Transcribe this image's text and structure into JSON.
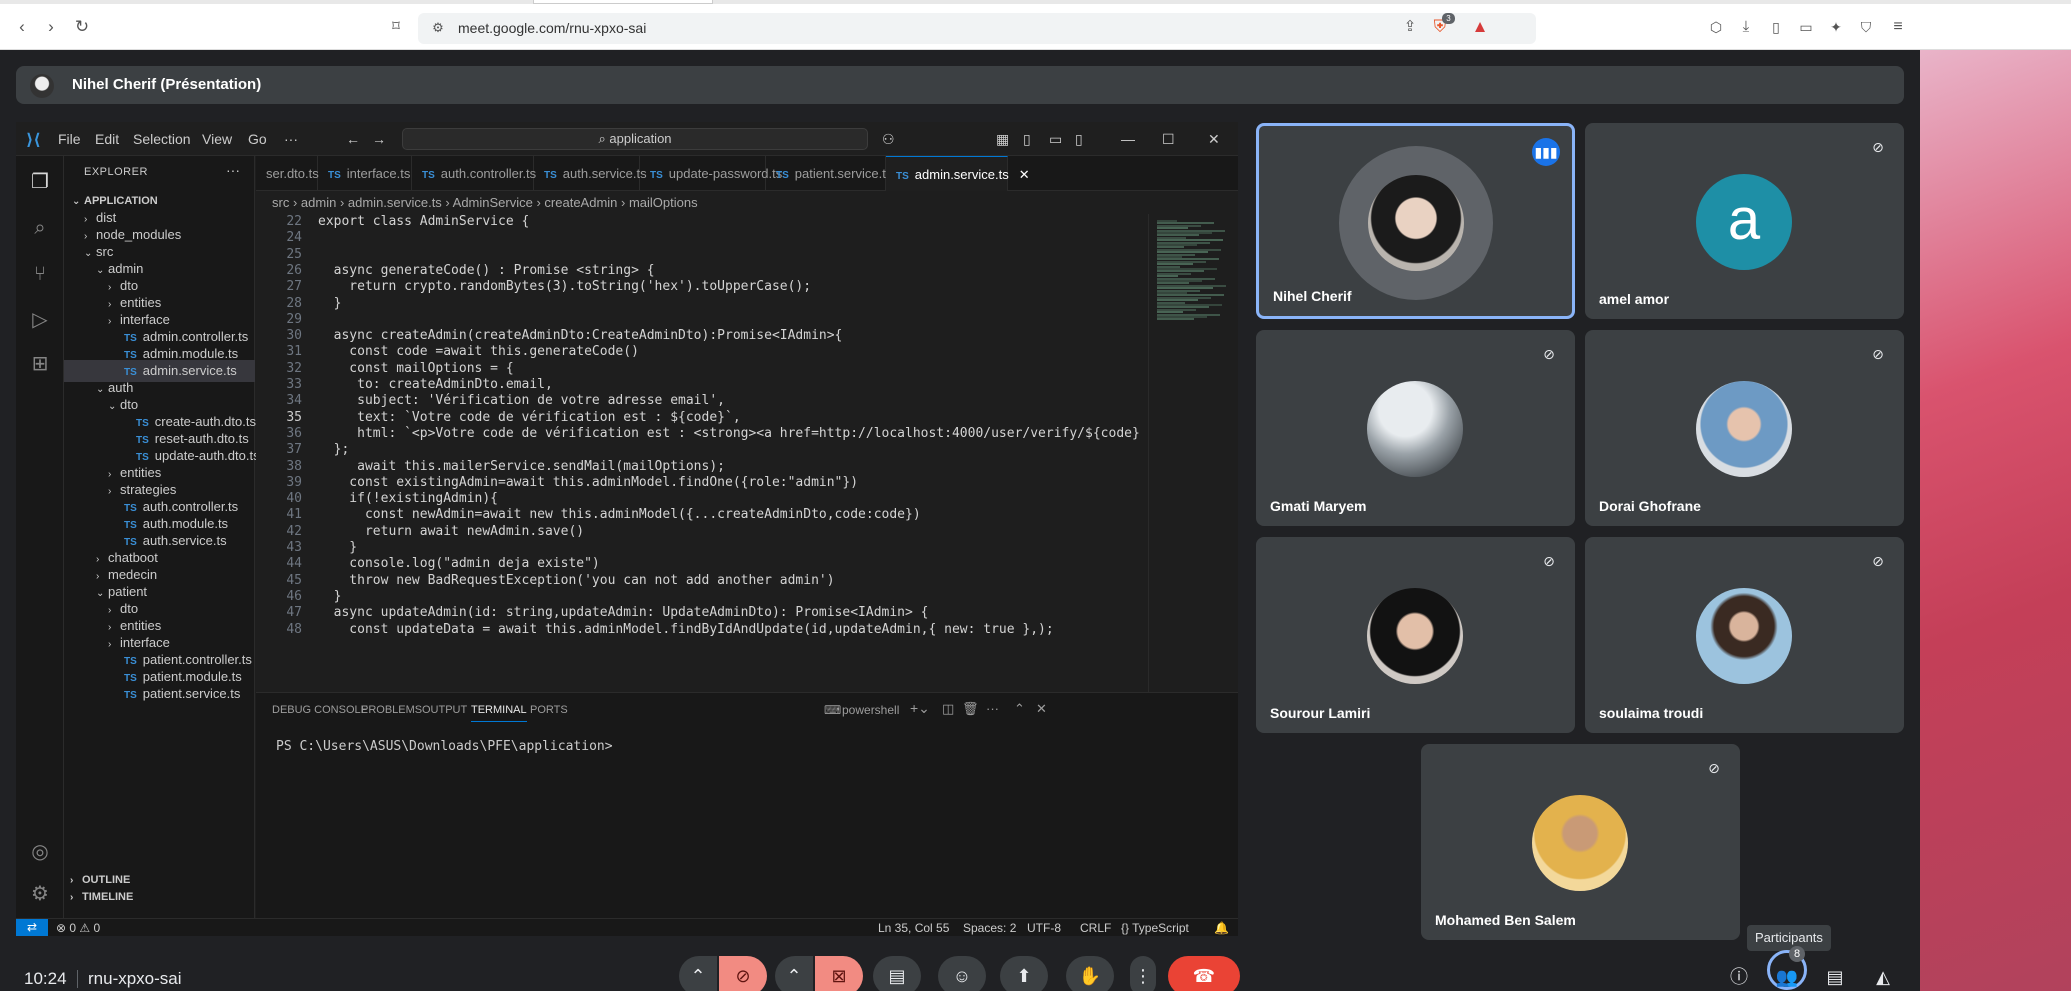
{
  "browser": {
    "url": "meet.google.com/rnu-xpxo-sai",
    "shield_badge": "3"
  },
  "meet": {
    "presenter_label": "Nihel Cherif (Présentation)",
    "clock": "10:24",
    "meeting_code": "rnu-xpxo-sai",
    "tooltip": "Participants",
    "participant_count": "8",
    "tiles": [
      {
        "name": "Nihel Cherif",
        "muted": false,
        "speaking": true
      },
      {
        "name": "amel amor",
        "muted": true,
        "initial": "a"
      },
      {
        "name": "Gmati Maryem",
        "muted": true
      },
      {
        "name": "Dorai Ghofrane",
        "muted": true
      },
      {
        "name": "Sourour Lamiri",
        "muted": true
      },
      {
        "name": "soulaima troudi",
        "muted": true
      },
      {
        "name": "Mohamed Ben Salem",
        "muted": true
      }
    ],
    "colors": {
      "accent": "#8ab4f8",
      "end_call": "#ea4335",
      "muted_bg": "#f28b82"
    }
  },
  "vscode": {
    "menu": [
      "File",
      "Edit",
      "Selection",
      "View",
      "Go",
      "···"
    ],
    "search": "application",
    "explorer_title": "EXPLORER",
    "tree": [
      {
        "label": "APPLICATION",
        "indent": 0,
        "kind": "root"
      },
      {
        "label": "dist",
        "indent": 1,
        "kind": "folder"
      },
      {
        "label": "node_modules",
        "indent": 1,
        "kind": "folder"
      },
      {
        "label": "src",
        "indent": 1,
        "kind": "open"
      },
      {
        "label": "admin",
        "indent": 2,
        "kind": "open"
      },
      {
        "label": "dto",
        "indent": 3,
        "kind": "folder"
      },
      {
        "label": "entities",
        "indent": 3,
        "kind": "folder"
      },
      {
        "label": "interface",
        "indent": 3,
        "kind": "folder"
      },
      {
        "label": "admin.controller.ts",
        "indent": 3,
        "kind": "file"
      },
      {
        "label": "admin.module.ts",
        "indent": 3,
        "kind": "file"
      },
      {
        "label": "admin.service.ts",
        "indent": 3,
        "kind": "file",
        "selected": true
      },
      {
        "label": "auth",
        "indent": 2,
        "kind": "open"
      },
      {
        "label": "dto",
        "indent": 3,
        "kind": "open"
      },
      {
        "label": "create-auth.dto.ts",
        "indent": 4,
        "kind": "file"
      },
      {
        "label": "reset-auth.dto.ts",
        "indent": 4,
        "kind": "file"
      },
      {
        "label": "update-auth.dto.ts",
        "indent": 4,
        "kind": "file"
      },
      {
        "label": "entities",
        "indent": 3,
        "kind": "folder"
      },
      {
        "label": "strategies",
        "indent": 3,
        "kind": "folder"
      },
      {
        "label": "auth.controller.ts",
        "indent": 3,
        "kind": "file"
      },
      {
        "label": "auth.module.ts",
        "indent": 3,
        "kind": "file"
      },
      {
        "label": "auth.service.ts",
        "indent": 3,
        "kind": "file"
      },
      {
        "label": "chatboot",
        "indent": 2,
        "kind": "folder"
      },
      {
        "label": "medecin",
        "indent": 2,
        "kind": "folder"
      },
      {
        "label": "patient",
        "indent": 2,
        "kind": "open"
      },
      {
        "label": "dto",
        "indent": 3,
        "kind": "folder"
      },
      {
        "label": "entities",
        "indent": 3,
        "kind": "folder"
      },
      {
        "label": "interface",
        "indent": 3,
        "kind": "folder"
      },
      {
        "label": "patient.controller.ts",
        "indent": 3,
        "kind": "file"
      },
      {
        "label": "patient.module.ts",
        "indent": 3,
        "kind": "file"
      },
      {
        "label": "patient.service.ts",
        "indent": 3,
        "kind": "file"
      }
    ],
    "outline": "OUTLINE",
    "timeline": "TIMELINE",
    "tabs": [
      {
        "label": "ser.dto.ts",
        "ts": false
      },
      {
        "label": "interface.ts",
        "ts": true
      },
      {
        "label": "auth.controller.ts",
        "ts": true
      },
      {
        "label": "auth.service.ts",
        "ts": true
      },
      {
        "label": "update-password.ts",
        "ts": true
      },
      {
        "label": "patient.service.ts",
        "ts": true
      },
      {
        "label": "admin.service.ts",
        "ts": true,
        "active": true
      }
    ],
    "breadcrumb": [
      "src",
      "admin",
      "admin.service.ts",
      "AdminService",
      "createAdmin",
      "mailOptions"
    ],
    "code": [
      {
        "n": "22",
        "text": "export class AdminService {"
      },
      {
        "n": "24",
        "text": ""
      },
      {
        "n": "25",
        "text": ""
      },
      {
        "n": "26",
        "text": "  async generateCode() : Promise <string> {"
      },
      {
        "n": "27",
        "text": "    return crypto.randomBytes(3).toString('hex').toUpperCase();"
      },
      {
        "n": "28",
        "text": "  }"
      },
      {
        "n": "29",
        "text": ""
      },
      {
        "n": "30",
        "text": "  async createAdmin(createAdminDto:CreateAdminDto):Promise<IAdmin>{"
      },
      {
        "n": "31",
        "text": "    const code =await this.generateCode()"
      },
      {
        "n": "32",
        "text": "    const mailOptions = {"
      },
      {
        "n": "33",
        "text": "     to: createAdminDto.email,"
      },
      {
        "n": "34",
        "text": "     subject: 'Vérification de votre adresse email',"
      },
      {
        "n": "35",
        "text": "     text: `Votre code de vérification est : ${code}`,"
      },
      {
        "n": "36",
        "text": "     html: `<p>Votre code de vérification est : <strong><a href=http://localhost:4000/user/verify/${code}"
      },
      {
        "n": "37",
        "text": "  };"
      },
      {
        "n": "38",
        "text": "     await this.mailerService.sendMail(mailOptions);"
      },
      {
        "n": "39",
        "text": "    const existingAdmin=await this.adminModel.findOne({role:\"admin\"})"
      },
      {
        "n": "40",
        "text": "    if(!existingAdmin){"
      },
      {
        "n": "41",
        "text": "      const newAdmin=await new this.adminModel({...createAdminDto,code:code})"
      },
      {
        "n": "42",
        "text": "      return await newAdmin.save()"
      },
      {
        "n": "43",
        "text": "    }"
      },
      {
        "n": "44",
        "text": "    console.log(\"admin deja existe\")"
      },
      {
        "n": "45",
        "text": "    throw new BadRequestException('you can not add another admin')"
      },
      {
        "n": "46",
        "text": "  }"
      },
      {
        "n": "47",
        "text": "  async updateAdmin(id: string,updateAdmin: UpdateAdminDto): Promise<IAdmin> {"
      },
      {
        "n": "48",
        "text": "    const updateData = await this.adminModel.findByIdAndUpdate(id,updateAdmin,{ new: true },);"
      }
    ],
    "current_line": "35",
    "panel_tabs": [
      "DEBUG CONSOLE",
      "PROBLEMS",
      "OUTPUT",
      "TERMINAL",
      "PORTS"
    ],
    "terminal_label": "powershell",
    "terminal_prompt": "PS C:\\Users\\ASUS\\Downloads\\PFE\\application>",
    "status": {
      "problems": "⊗ 0 ⚠ 0",
      "cursor": "Ln 35, Col 55",
      "spaces": "Spaces: 2",
      "encoding": "UTF-8",
      "eol": "CRLF",
      "language": "{} TypeScript"
    }
  }
}
